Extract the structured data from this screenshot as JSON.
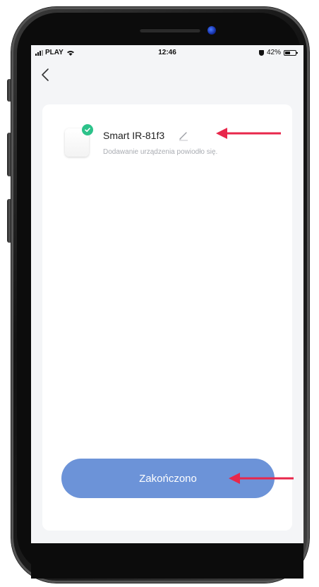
{
  "status_bar": {
    "carrier": "PLAY",
    "time": "12:46",
    "battery": "42%"
  },
  "icons": {
    "back": "chevron-left-icon",
    "edit": "pencil-icon",
    "check": "check-circle-icon",
    "annotation": "arrow-left-icon"
  },
  "device": {
    "name": "Smart IR-81f3",
    "status": "Dodawanie urządzenia powiodło się."
  },
  "done_button": {
    "label": "Zakończono"
  },
  "colors": {
    "accent": "#6c93d8",
    "success": "#2cc28a",
    "annotation_arrow": "#e8274b"
  }
}
